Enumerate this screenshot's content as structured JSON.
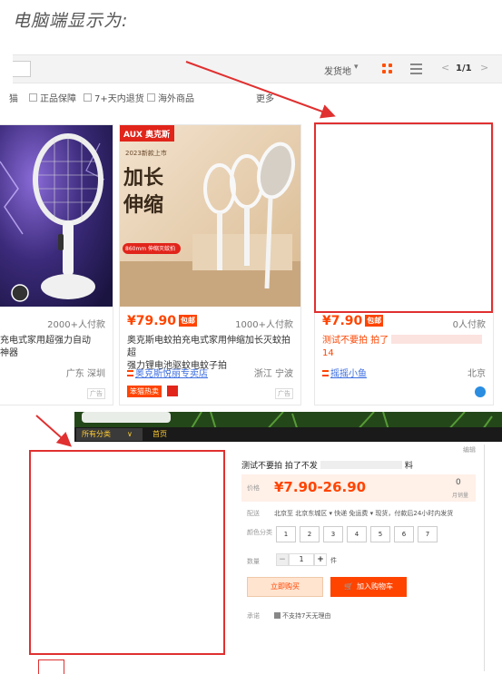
{
  "heading": "电脑端显示为:",
  "toolbar": {
    "ship_from": "发货地",
    "pagination": "1/1",
    "prev": "<",
    "next": ">",
    "caret": "▾"
  },
  "filters": {
    "items": [
      "猫",
      "正品保障",
      "7+天内退货",
      "海外商品"
    ],
    "more": "更多"
  },
  "cards": [
    {
      "price": "",
      "paid": "2000+人付款",
      "title_line1": "充电式家用超强力自动",
      "title_line2": "神器",
      "shop": "",
      "location": "广东 深圳",
      "ad": "广告"
    },
    {
      "brand": "AUX 奥克斯",
      "promo_new": "2023新款上市",
      "promo_big1": "加长",
      "promo_big2": "伸缩",
      "promo_tag": "860mm 伸缩灭蚊拍",
      "price": "¥79.90",
      "badge": "包邮",
      "paid": "1000+人付款",
      "title_line1": "奥克斯电蚊拍充电式家用伸缩加长灭蚊拍超",
      "title_line2": "强力锂电池驱蚊电蚊子拍",
      "shop": "奥克斯悦丽专卖店",
      "location": "浙江 宁波",
      "tag": "笨猫热卖",
      "ad": "广告"
    },
    {
      "price": "¥7.90",
      "badge": "包邮",
      "paid": "0人付款",
      "title_line1": "测试不要拍 拍了",
      "title_line2": "14",
      "shop": "摇摇小鱼",
      "location": "北京"
    }
  ],
  "detail": {
    "nav_menu": "所有分类",
    "nav_menu_caret": "∨",
    "nav_home": "首页",
    "edit": "编辑",
    "title": "测试不要拍 拍了不发",
    "title_tail": "料",
    "price_label": "价格",
    "price": "¥7.90-26.90",
    "monthly_num": "0",
    "monthly_label": "月销量",
    "ship_label": "配送",
    "ship_text": "北京至 北京东城区 ▾  快递 免运费 ▾  现货，付款后24小时内发货",
    "color_label": "颜色分类",
    "skus": [
      "1",
      "2",
      "3",
      "4",
      "5",
      "6",
      "7"
    ],
    "qty_label": "数量",
    "qty_minus": "−",
    "qty_value": "1",
    "qty_plus": "+",
    "qty_unit": "件",
    "buy_now": "立即购买",
    "add_cart": "加入购物车",
    "cart_icon": "🛒",
    "promise_label": "承诺",
    "promise_text": "不支持7天无理由"
  },
  "colors": {
    "accent": "#ff4400",
    "annotation_red": "#e03030",
    "link_blue": "#3d6ee0"
  }
}
